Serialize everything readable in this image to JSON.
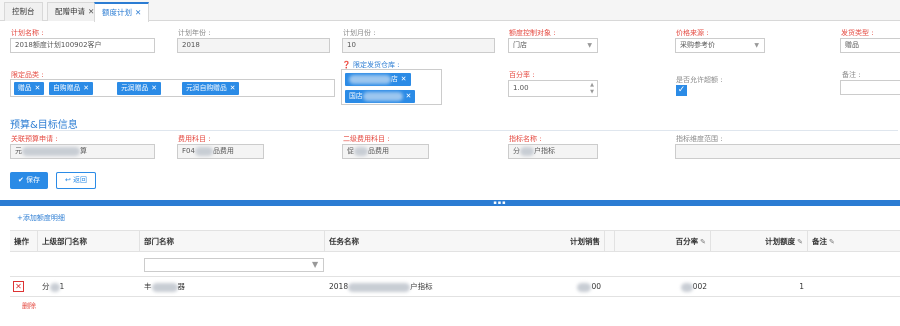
{
  "tabs": [
    {
      "label": "控制台",
      "closable": false,
      "active": false
    },
    {
      "label": "配赠申请",
      "closable": true,
      "active": false
    },
    {
      "label": "额度计划",
      "closable": true,
      "active": true
    }
  ],
  "form": {
    "plan_name": {
      "label": "计划名称 :",
      "value": "2018额度计划100902客户"
    },
    "plan_year": {
      "label": "计划年份 :",
      "value": "2018"
    },
    "plan_month": {
      "label": "计划月份 :",
      "value": "10"
    },
    "quota_object": {
      "label": "额度控制对象 :",
      "value": "门店"
    },
    "price_source": {
      "label": "价格来源 :",
      "value": "采购参考价"
    },
    "delivery_type": {
      "label": "发货类型 :",
      "value": "赠品"
    },
    "limited_categories": {
      "label": "限定品类 :",
      "tags": [
        "赠品",
        "自购赠品",
        "元润赠品",
        "元润自购赠品"
      ]
    },
    "limited_warehouse": {
      "label": "限定发货仓库 :",
      "tags": [
        "店",
        "国店"
      ]
    },
    "percentage": {
      "label": "百分率 :",
      "value": "1.00"
    },
    "allow_exceed": {
      "label": "是否允许超额 :",
      "checked": true
    },
    "remark": {
      "label": "备注 :",
      "value": ""
    }
  },
  "budget": {
    "title": "预算&目标信息",
    "budget_apply": {
      "label": "关联预算申请 :",
      "value_prefix": "元",
      "value_suffix": "算"
    },
    "expense_subject": {
      "label": "费用科目 :",
      "value_prefix": "F04",
      "value_suffix": "品费用"
    },
    "secondary_subject": {
      "label": "二级费用科目 :",
      "value_prefix": "促",
      "value_suffix": "品费用"
    },
    "indicator_name": {
      "label": "指标名称 :",
      "value_prefix": "分",
      "value_suffix": "户指标"
    },
    "indicator_scope": {
      "label": "指标维度范围 :",
      "value": ""
    }
  },
  "buttons": {
    "save": "保存",
    "back": "返回"
  },
  "detail": {
    "add_label": "+添加额度明细",
    "columns": [
      "操作",
      "上级部门名称",
      "部门名称",
      "任务名称",
      "计划销售",
      "百分率",
      "计划额度",
      "备注"
    ],
    "row": {
      "parent_dept_prefix": "分",
      "parent_dept_suffix": "1",
      "dept_prefix": "丰",
      "dept_suffix": "器",
      "task_prefix": "2018",
      "task_suffix": "户指标",
      "planned_sales_suffix": "00",
      "percentage_suffix": "002",
      "planned_quota": "1",
      "remark": ""
    },
    "delete_label": "删除"
  },
  "colors": {
    "accent": "#2b8be6",
    "required_label": "#e4473e",
    "tab_active": "#2b7cd3"
  }
}
